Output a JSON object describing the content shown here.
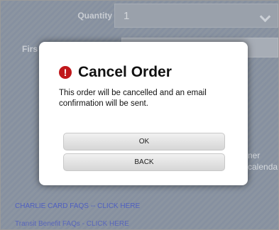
{
  "form": {
    "quantity_label": "Quantity",
    "quantity_value": "1",
    "first_label_partial": "Firs",
    "side_text_line1": "ner",
    "side_text_line2": "calenda"
  },
  "links": {
    "charlie_card": "CHARLIE CARD FAQS -- CLICK HERE",
    "transit_prefix": "Transit Benefit FAQs - ",
    "transit_link": "CLICK HERE"
  },
  "dialog": {
    "title": "Cancel Order",
    "message": "This order will be cancelled and an email confirmation will be sent.",
    "ok_label": "OK",
    "back_label": "BACK",
    "icon": "alert-circle-icon"
  },
  "colors": {
    "overlay": "#8c95a1",
    "alert_icon": "#c0171b",
    "link": "#4f5fc0"
  }
}
